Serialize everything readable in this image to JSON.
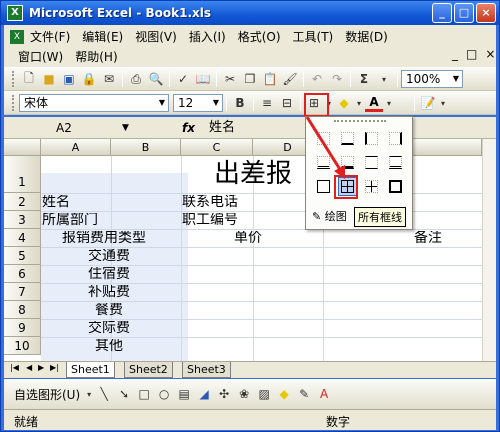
{
  "window": {
    "title": "Microsoft Excel - Book1.xls",
    "app_icon": "X"
  },
  "menu": {
    "row1": [
      "文件(F)",
      "编辑(E)",
      "视图(V)",
      "插入(I)",
      "格式(O)",
      "工具(T)",
      "数据(D)"
    ],
    "row2": [
      "窗口(W)",
      "帮助(H)"
    ],
    "doc_controls": [
      "_",
      "□",
      "×"
    ]
  },
  "toolbar_standard": {
    "zoom": "100%",
    "sum": "Σ"
  },
  "toolbar_format": {
    "font": "宋体",
    "size": "12",
    "bold": "B",
    "font_color_letter": "A"
  },
  "formula_bar": {
    "name_box": "A2",
    "fx": "fx",
    "value": "姓名"
  },
  "grid": {
    "columns": [
      "A",
      "B",
      "C",
      "D",
      "F"
    ],
    "rows": [
      "1",
      "2",
      "3",
      "4",
      "5",
      "6",
      "7",
      "8",
      "9",
      "10"
    ],
    "cells": {
      "title": "出差报",
      "r2a": "姓名",
      "r2c": "联系电话",
      "r3a": "所属部门",
      "r3c": "职工编号",
      "r4ab": "报销费用类型",
      "r4c": "单价",
      "r4f": "备注",
      "r5": "交通费",
      "r6": "住宿费",
      "r7": "补贴费",
      "r8": "餐费",
      "r9": "交际费",
      "r10": "其他"
    }
  },
  "sheets": {
    "tabs": [
      "Sheet1",
      "Sheet2",
      "Sheet3"
    ],
    "active": "Sheet1"
  },
  "draw_toolbar": {
    "autoshapes": "自选图形(U)"
  },
  "borders_popup": {
    "draw_label": "绘图",
    "tooltip": "所有框线"
  },
  "status": {
    "left": "就绪",
    "right": "数字"
  },
  "colors": {
    "highlight": "#e02020",
    "title_blue": "#1357d4"
  }
}
